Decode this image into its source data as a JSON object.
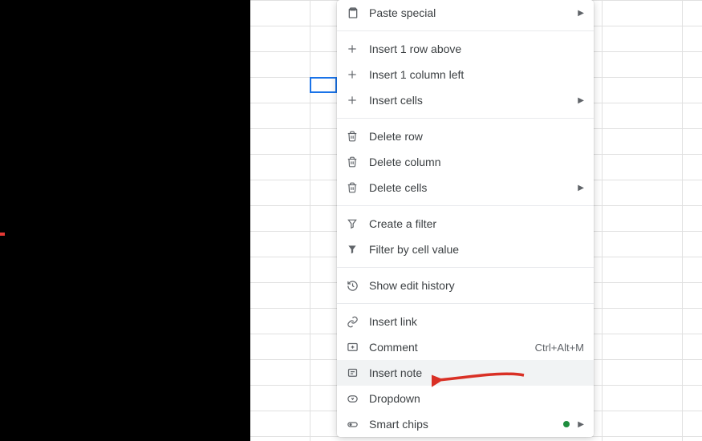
{
  "menu": {
    "paste_special": "Paste special",
    "insert_row_above": "Insert 1 row above",
    "insert_column_left": "Insert 1 column left",
    "insert_cells": "Insert cells",
    "delete_row": "Delete row",
    "delete_column": "Delete column",
    "delete_cells": "Delete cells",
    "create_filter": "Create a filter",
    "filter_by_cell": "Filter by cell value",
    "show_edit_history": "Show edit history",
    "insert_link": "Insert link",
    "comment": "Comment",
    "comment_shortcut": "Ctrl+Alt+M",
    "insert_note": "Insert note",
    "dropdown": "Dropdown",
    "smart_chips": "Smart chips"
  }
}
